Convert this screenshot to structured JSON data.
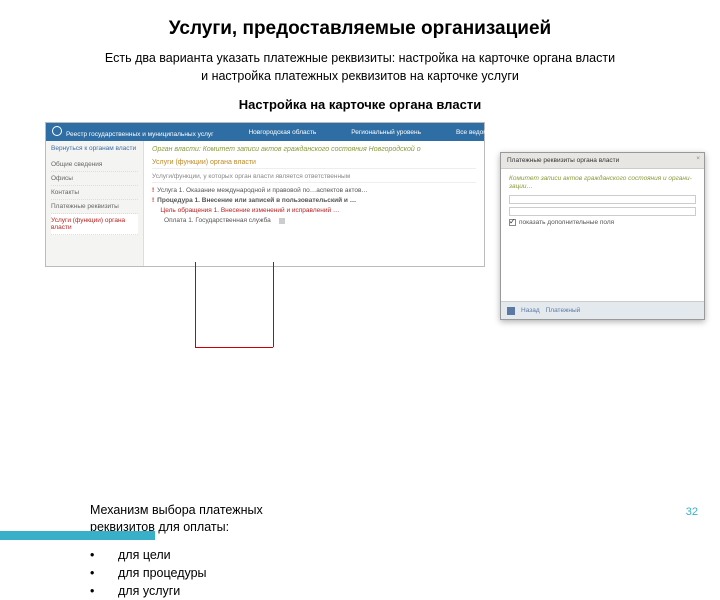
{
  "title": "Услуги, предоставляемые организацией",
  "subtitle_l1": "Есть два варианта указать платежные реквизиты: настройка на карточке органа власти",
  "subtitle_l2": "и настройка платежных реквизитов на карточке услуги",
  "section_heading": "Настройка на карточке органа власти",
  "main_window": {
    "topbar": {
      "logo_label": "Реестр государственных и муниципальных услуг",
      "region": "Новгородская область",
      "level": "Региональный уровень",
      "scope": "Все ведомства выбранной территории"
    },
    "sidebar": {
      "back": "Вернуться к органам власти",
      "items": [
        "Общие сведения",
        "Офисы",
        "Контакты",
        "Платежные реквизиты"
      ],
      "active": "Услуги (функции) органа власти"
    },
    "content": {
      "authority": "Орган власти: Комитет записи актов гражданского состояния Новгородской о",
      "tab_main": "Услуги (функции) органа власти",
      "tab_sub": "Услуги/функции, у которых орган власти является ответственным",
      "rows": {
        "service": "Услуга 1. Оказание международной и правовой по…аспектов актов…",
        "procedure": "Процедура 1. Внесение или записей в пользовательский и …",
        "goal": "Цель обращения 1. Внесение изменений и исправлений …",
        "payment": "Оплата 1. Государственная служба"
      }
    }
  },
  "popup": {
    "titlebar": "Платежные реквизиты органа власти",
    "close": "×",
    "heading": "Комитет записи актов гражданского состояния и органи-зации…",
    "field1_label": "",
    "field2_label": "",
    "checkbox_label": "показать дополнительные поля",
    "footer_btn1": "Назад",
    "footer_btn2": "Платежный"
  },
  "mechanism_l1": "Механизм выбора платежных",
  "mechanism_l2": "реквизитов для оплаты:",
  "bullets": [
    "для цели",
    "для процедуры",
    "для услуги"
  ],
  "page_number": "32"
}
